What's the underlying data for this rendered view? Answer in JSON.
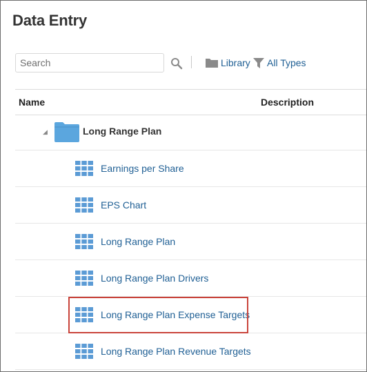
{
  "page": {
    "title": "Data Entry"
  },
  "toolbar": {
    "search_placeholder": "Search",
    "search_value": "",
    "library_label": "Library",
    "types_label": "All Types"
  },
  "table": {
    "columns": {
      "name": "Name",
      "description": "Description"
    },
    "folder": {
      "label": "Long Range Plan",
      "expanded": true,
      "icon": "folder-icon"
    },
    "forms": [
      {
        "label": "Earnings per Share",
        "description": "",
        "icon": "form-grid-icon"
      },
      {
        "label": "EPS Chart",
        "description": "",
        "icon": "form-grid-icon"
      },
      {
        "label": "Long Range Plan",
        "description": "",
        "icon": "form-grid-icon"
      },
      {
        "label": "Long Range Plan Drivers",
        "description": "",
        "icon": "form-grid-icon"
      },
      {
        "label": "Long Range Plan Expense Targets",
        "description": "",
        "icon": "form-grid-icon",
        "highlighted": true
      },
      {
        "label": "Long Range Plan Revenue Targets",
        "description": "",
        "icon": "form-grid-icon"
      }
    ]
  },
  "colors": {
    "link": "#1f5f94",
    "folder": "#5ba6de",
    "grid_icon": "#5b9bd5",
    "highlight_border": "#c9433a"
  }
}
